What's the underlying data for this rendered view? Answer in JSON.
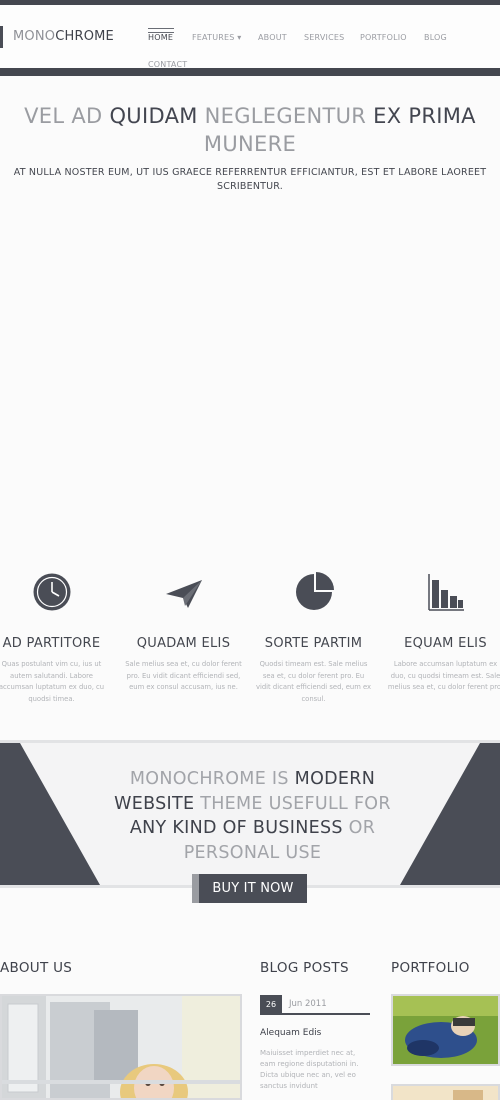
{
  "header": {
    "logo_light": "MONO",
    "logo_dark": "CHROME",
    "nav": [
      {
        "label": "HOME"
      },
      {
        "label": "FEATURES ▾"
      },
      {
        "label": "ABOUT"
      },
      {
        "label": "SERVICES"
      },
      {
        "label": "PORTFOLIO"
      },
      {
        "label": "BLOG"
      },
      {
        "label": "CONTACT"
      }
    ]
  },
  "hero": {
    "t1": "VEL AD ",
    "t2": "QUIDAM",
    "t3": " NEGLEGENTUR ",
    "t4": "EX PRIMA",
    "t5": "MUNERE",
    "subtitle": "AT NULLA NOSTER EUM, UT IUS GRAECE REFERRENTUR EFFICIANTUR, EST ET LABORE LAOREET SCRIBENTUR."
  },
  "features": [
    {
      "icon": "clock-icon",
      "title": "AD PARTITORE",
      "text": "Quas postulant vim cu, ius ut autem salutandi. Labore accumsan luptatum ex duo, cu quodsi timea."
    },
    {
      "icon": "paper-plane-icon",
      "title": "QUADAM ELIS",
      "text": "Sale melius sea et, cu dolor ferent pro. Eu vidit dicant efficiendi sed, eum ex consul accusam, ius ne."
    },
    {
      "icon": "pie-chart-icon",
      "title": "SORTE PARTIM",
      "text": "Quodsi timeam est. Sale melius sea et, cu dolor ferent pro. Eu vidit dicant efficiendi sed, eum ex consul."
    },
    {
      "icon": "bar-chart-icon",
      "title": "EQUAM ELIS",
      "text": "Labore accumsan luptatum ex duo, cu quodsi timeam est. Sale melius sea et, cu dolor ferent pro."
    }
  ],
  "promo": {
    "p1": "MONOCHROME IS ",
    "p2": "MODERN",
    "p3": "WEBSITE",
    "p4": " THEME USEFULL FOR ",
    "p5": "ANY KIND OF BUSINESS",
    "p6": " OR PERSONAL USE",
    "button": "BUY IT NOW"
  },
  "sections": {
    "about": "ABOUT US",
    "blog": "BLOG POSTS",
    "portfolio": "PORTFOLIO"
  },
  "blog_post": {
    "day": "26",
    "month": "Jun 2011",
    "title": "Alequam Edis",
    "excerpt": "Maiuisset imperdiet nec at, eam regione disputationi in. Dicta ubique nec an, vel eo sanctus invidunt"
  },
  "colors": {
    "dark": "#44474f",
    "light_text": "#9a9ca1"
  }
}
